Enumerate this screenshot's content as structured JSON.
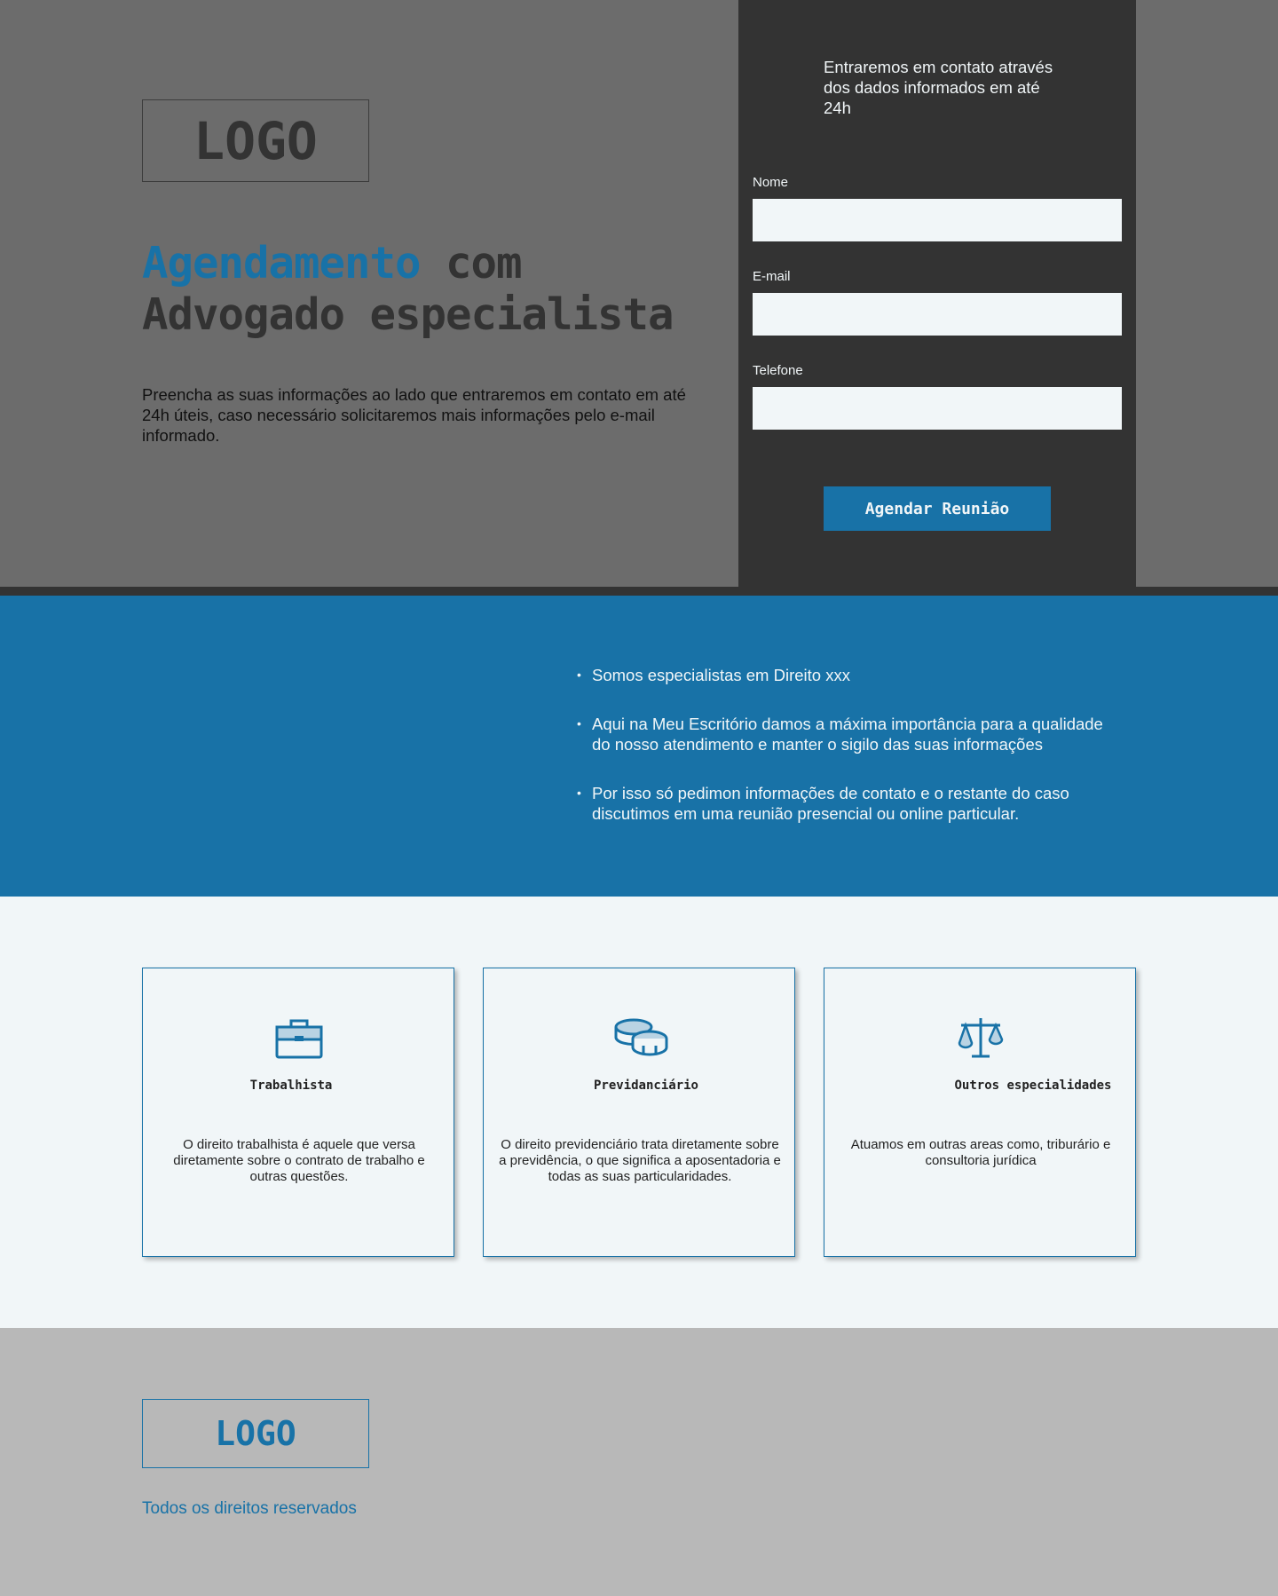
{
  "hero": {
    "logo": "LOGO",
    "headline_accent": "Agendamento",
    "headline_rest": " com Advogado especialista",
    "description": "Preencha as suas informações ao lado que entraremos em contato em até 24h úteis, caso necessário solicitaremos mais informações pelo e-mail informado."
  },
  "form": {
    "intro": "Entraremos em contato através dos dados informados em até 24h",
    "fields": [
      {
        "label": "Nome",
        "value": "",
        "placeholder": ""
      },
      {
        "label": "E-mail",
        "value": "",
        "placeholder": ""
      },
      {
        "label": "Telefone",
        "value": "",
        "placeholder": ""
      }
    ],
    "submit_label": "Agendar Reunião"
  },
  "info": {
    "items": [
      "Somos especialistas em Direito xxx",
      "Aqui na Meu Escritório damos a máxima importância para a qualidade do nosso atendimento e manter o sigilo das suas informações",
      "Por isso só pedimon informações de contato e o restante do caso discutimos em uma reunião presencial ou online particular."
    ]
  },
  "services": [
    {
      "icon": "briefcase-icon",
      "title": "Trabalhista",
      "description": "O direito trabalhista é aquele que versa diretamente sobre o contrato de trabalho e outras questões."
    },
    {
      "icon": "coins-icon",
      "title": "Previdanciário",
      "description": "O direito previdenciário trata diretamente sobre a previdência, o que significa a aposentadoria e todas as suas particularidades."
    },
    {
      "icon": "scales-icon",
      "title": "Outros especialidades",
      "description": "Atuamos em outras areas como, triburário e consultoria jurídica"
    }
  ],
  "footer": {
    "logo": "LOGO",
    "copyright": "Todos os direitos reservados"
  },
  "colors": {
    "accent": "#1872a7",
    "dark": "#333333",
    "hero_bg": "#6c6c6c",
    "light": "#f1f6f8",
    "footer_bg": "#b8b8b8"
  }
}
